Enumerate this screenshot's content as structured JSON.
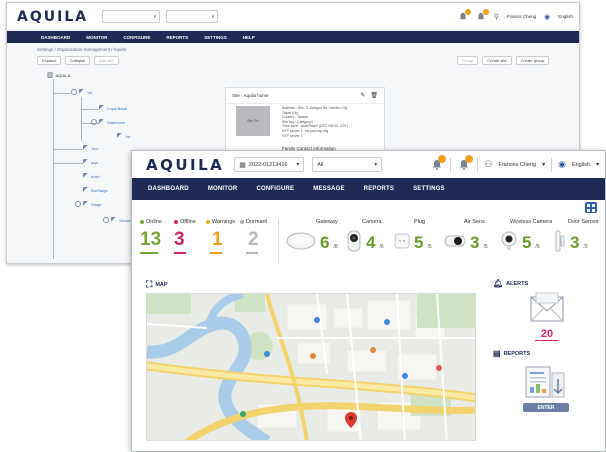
{
  "back": {
    "logo": "AQUILA",
    "selector1": "",
    "selector2": "",
    "user": "Francis Cheng",
    "language": "English",
    "nav": [
      "DASHBOARD",
      "MONITOR",
      "CONFIGURE",
      "REPORTS",
      "SETTINGS",
      "HELP"
    ],
    "breadcrumb": "Settings / Organization management / Aquila",
    "tools": [
      "Expand",
      "Collapse",
      "Add site"
    ],
    "tools_right": [
      "Group",
      "Create site",
      "Create group"
    ],
    "tree_root": "AQUILA",
    "tree_nodes": [
      "1st",
      "Loyal Bank",
      "Stanhome",
      "1st",
      "1ed",
      "aqa",
      "hotel",
      "BarStage",
      "Stage",
      "Second",
      "Stage"
    ],
    "site_card": {
      "title": "Site - Aquila home",
      "photo_label": "Site Pic",
      "info": [
        "Address   : Sec. 3, Jianguo Rd, Nantou City",
        "              Taipei City",
        "Country   : Taiwan",
        "Site tag  : Category1",
        "Time zone : Asia/Taipei (UTC+08:00, CST)",
        "NTP server 1 : tw.pool.ntp.org",
        "NTP server 2 :"
      ],
      "family_label": "Family Contact Information"
    }
  },
  "front": {
    "logo": "AQUILA",
    "date_selector": "2022-01213416",
    "filter_selector": "All",
    "user": "Frances Cheng",
    "language": "English",
    "nav": [
      "DASHBOARD",
      "MONITOR",
      "CONFIGURE",
      "MESSAGE",
      "REPORTS",
      "SETTINGS"
    ],
    "status": [
      {
        "label": "Online",
        "value": "13",
        "color": "#7aa63a"
      },
      {
        "label": "Offline",
        "value": "3",
        "color": "#d0285b"
      },
      {
        "label": "Warnings",
        "value": "1",
        "color": "#f0a21c"
      },
      {
        "label": "Dormant",
        "value": "2",
        "color": "#a9adb5"
      }
    ],
    "devices": [
      {
        "name": "Gateway",
        "count": "6",
        "total": "/8",
        "icon": "gateway-icon"
      },
      {
        "name": "Camera",
        "count": "4",
        "total": "/6",
        "icon": "camera-icon"
      },
      {
        "name": "Plug",
        "count": "5",
        "total": "/5",
        "icon": "plug-icon"
      },
      {
        "name": "Air Sens",
        "count": "3",
        "total": "/5",
        "icon": "air-sensor-icon"
      },
      {
        "name": "Wireless Camera",
        "count": "5",
        "total": "/5",
        "icon": "wireless-camera-icon"
      },
      {
        "name": "Door Sensor",
        "count": "3",
        "total": "/3",
        "icon": "door-sensor-icon"
      }
    ],
    "map_title": "MAP",
    "alerts_title": "ALERTS",
    "alerts_count": "20",
    "reports_title": "REPORTS",
    "enter_label": "ENTER"
  },
  "colors": {
    "navy": "#1f2a55",
    "accent_green": "#6a9c2a",
    "alert_red": "#d0285b",
    "warning_orange": "#f0a21c"
  }
}
